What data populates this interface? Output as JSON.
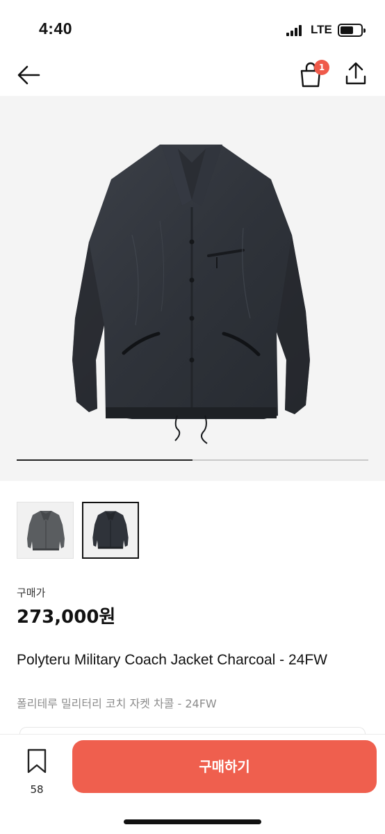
{
  "status_bar": {
    "time": "4:40",
    "network": "LTE"
  },
  "header": {
    "back_icon": "arrow-left-icon",
    "cart_icon": "shopping-bag-icon",
    "cart_badge": "1",
    "share_icon": "share-icon"
  },
  "gallery": {
    "image_count": 2,
    "current_index": 2,
    "progress_fraction": 0.5,
    "thumbnails": [
      {
        "icon": "jacket-image-gray",
        "selected": false
      },
      {
        "icon": "jacket-image-charcoal",
        "selected": true
      }
    ]
  },
  "product": {
    "price_label": "구매가",
    "price": "273,000원",
    "title_en": "Polyteru Military Coach Jacket Charcoal - 24FW",
    "title_ko": "폴리테루 밀리터리 코치 자켓 차콜 - 24FW"
  },
  "bottom_bar": {
    "bookmark_icon": "bookmark-icon",
    "bookmark_count": "58",
    "buy_label": "구매하기"
  },
  "colors": {
    "accent": "#ef5f4e",
    "badge": "#ef5a4a",
    "hero_background": "#f4f4f4",
    "jacket": "#33373d"
  }
}
